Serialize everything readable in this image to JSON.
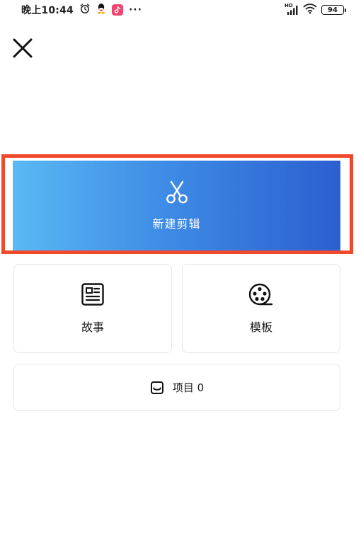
{
  "status_bar": {
    "time": "晚上10:44",
    "dots": "···",
    "network": "HD",
    "battery": "94"
  },
  "main": {
    "new_edit_label": "新建剪辑",
    "story_label": "故事",
    "template_label": "模板",
    "projects_label": "项目 0"
  },
  "colors": {
    "highlight_border": "#f04a2e",
    "gradient_start": "#5ab9f4",
    "gradient_end": "#2b5fd0"
  },
  "icons": {
    "close": "close-icon",
    "scissors": "scissors-icon",
    "story": "news-icon",
    "template": "film-reel-icon",
    "projects": "inbox-icon"
  }
}
